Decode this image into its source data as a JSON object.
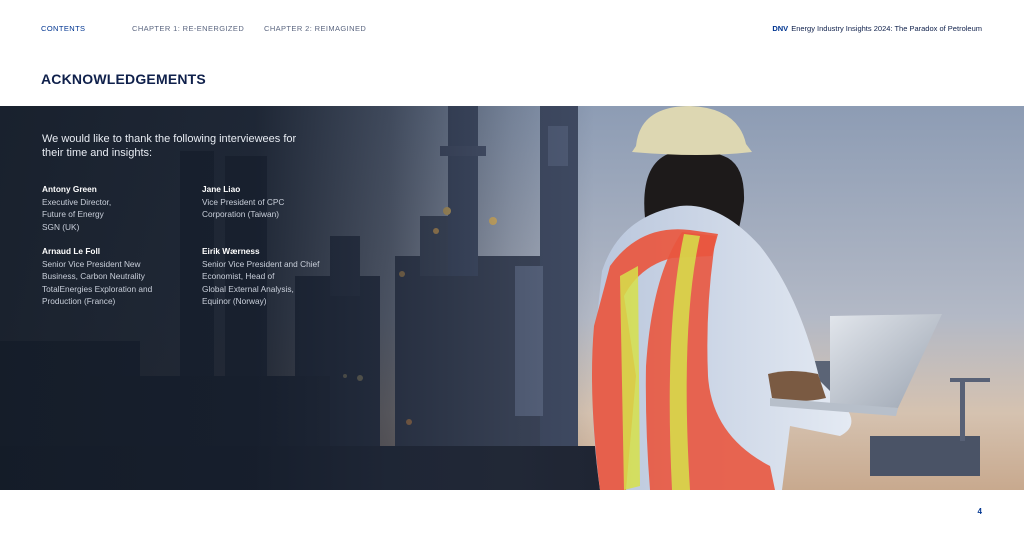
{
  "nav": {
    "contents": "CONTENTS",
    "chapter1": "CHAPTER 1: RE-ENERGIZED",
    "chapter2": "CHAPTER 2: REIMAGINED",
    "brand": "DNV",
    "doc_title": "Energy Industry Insights 2024: The Paradox of Petroleum"
  },
  "heading": "ACKNOWLEDGEMENTS",
  "hero": {
    "intro": "We would like to thank the following interviewees for their time and insights:",
    "people": [
      {
        "name": "Antony Green",
        "role": "Executive Director,\nFuture of Energy\nSGN (UK)"
      },
      {
        "name": "Jane Liao",
        "role": "Vice President of CPC\nCorporation (Taiwan)"
      },
      {
        "name": "Arnaud Le Foll",
        "role": "Senior Vice President New\nBusiness, Carbon Neutrality\nTotalEnergies Exploration and\nProduction (France)"
      },
      {
        "name": "Eirik Wærness",
        "role": "Senior Vice President and Chief\nEconomist, Head of\nGlobal External Analysis,\nEquinor (Norway)"
      }
    ]
  },
  "page_number": "4",
  "colors": {
    "brand_blue": "#003591",
    "navy": "#0f204b",
    "vest_orange": "#e9573f",
    "vest_yellow": "#d6e04a"
  }
}
